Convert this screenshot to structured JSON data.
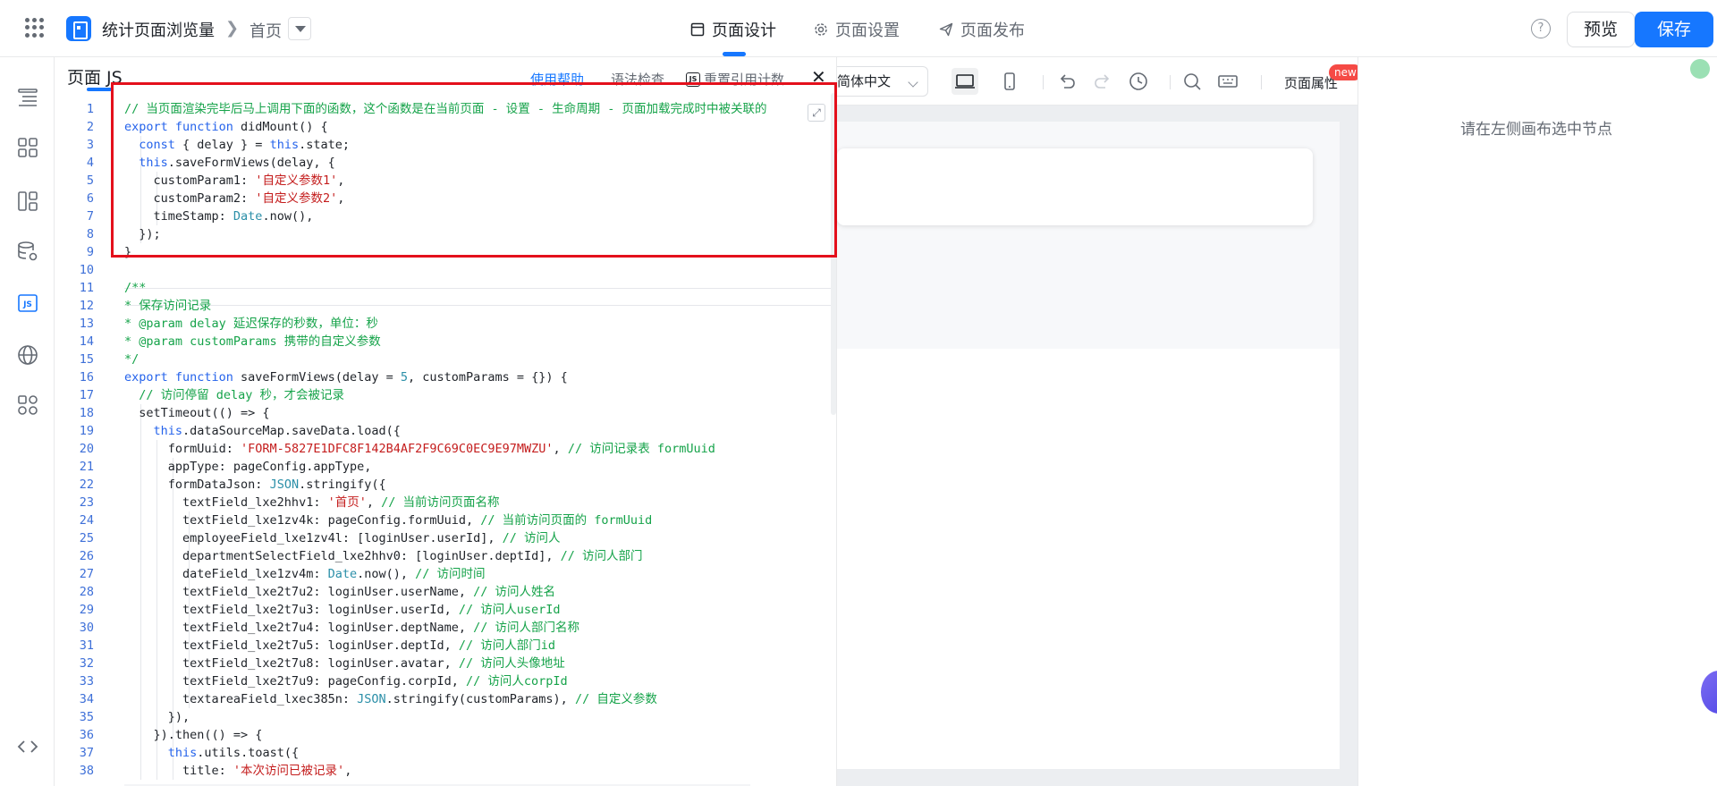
{
  "header": {
    "app_title": "统计页面浏览量",
    "breadcrumb_page": "首页",
    "tabs": [
      {
        "label": "页面设计",
        "active": true
      },
      {
        "label": "页面设置",
        "active": false
      },
      {
        "label": "页面发布",
        "active": false
      }
    ],
    "preview_label": "预览",
    "save_label": "保存",
    "help_glyph": "?"
  },
  "rail": {
    "icons": [
      "outline-icon",
      "components-icon",
      "layout-icon",
      "datasource-icon",
      "js-icon",
      "globe-icon",
      "plugins-icon",
      "code-icon"
    ],
    "js_label": "JS"
  },
  "code_panel": {
    "title": "页面 JS",
    "help_label": "使用帮助",
    "lint_label": "语法检查",
    "ref_label": "重置引用计数",
    "ref_icon_label": "JS",
    "close_glyph": "✕",
    "expand_glyph": "⤢",
    "lines": [
      [
        {
          "c": "cm",
          "t": "// 当页面渲染完毕后马上调用下面的函数，这个函数是在当前页面 - 设置 - 生命周期 - 页面加载完成时中被关联的"
        }
      ],
      [
        {
          "c": "kw",
          "t": "export function"
        },
        {
          "c": "",
          "t": " didMount() {"
        }
      ],
      [
        {
          "c": "",
          "t": "  "
        },
        {
          "c": "kw",
          "t": "const"
        },
        {
          "c": "",
          "t": " { delay } = "
        },
        {
          "c": "kw",
          "t": "this"
        },
        {
          "c": "",
          "t": ".state;"
        }
      ],
      [
        {
          "c": "",
          "t": "  "
        },
        {
          "c": "kw",
          "t": "this"
        },
        {
          "c": "",
          "t": ".saveFormViews(delay, {"
        }
      ],
      [
        {
          "c": "",
          "t": "    customParam1: "
        },
        {
          "c": "st",
          "t": "'自定义参数1'"
        },
        {
          "c": "",
          "t": ","
        }
      ],
      [
        {
          "c": "",
          "t": "    customParam2: "
        },
        {
          "c": "st",
          "t": "'自定义参数2'"
        },
        {
          "c": "",
          "t": ","
        }
      ],
      [
        {
          "c": "",
          "t": "    timeStamp: "
        },
        {
          "c": "ty",
          "t": "Date"
        },
        {
          "c": "",
          "t": ".now(),"
        }
      ],
      [
        {
          "c": "",
          "t": "  });"
        }
      ],
      [
        {
          "c": "",
          "t": "}"
        }
      ],
      [
        {
          "c": "",
          "t": ""
        }
      ],
      [
        {
          "c": "cm",
          "t": "/**"
        }
      ],
      [
        {
          "c": "cm",
          "t": "* 保存访问记录"
        }
      ],
      [
        {
          "c": "cm",
          "t": "* @param delay 延迟保存的秒数，单位：秒"
        }
      ],
      [
        {
          "c": "cm",
          "t": "* @param customParams 携带的自定义参数"
        }
      ],
      [
        {
          "c": "cm",
          "t": "*/"
        }
      ],
      [
        {
          "c": "kw",
          "t": "export function"
        },
        {
          "c": "",
          "t": " saveFormViews(delay = "
        },
        {
          "c": "ty",
          "t": "5"
        },
        {
          "c": "",
          "t": ", customParams = {}) {"
        }
      ],
      [
        {
          "c": "",
          "t": "  "
        },
        {
          "c": "cm",
          "t": "// 访问停留 delay 秒，才会被记录"
        }
      ],
      [
        {
          "c": "",
          "t": "  setTimeout(() => {"
        }
      ],
      [
        {
          "c": "",
          "t": "    "
        },
        {
          "c": "kw",
          "t": "this"
        },
        {
          "c": "",
          "t": ".dataSourceMap.saveData.load({"
        }
      ],
      [
        {
          "c": "",
          "t": "      formUuid: "
        },
        {
          "c": "st",
          "t": "'FORM-5827E1DFC8F142B4AF2F9C69C0EC9E97MWZU'"
        },
        {
          "c": "",
          "t": ", "
        },
        {
          "c": "cm",
          "t": "// 访问记录表 formUuid"
        }
      ],
      [
        {
          "c": "",
          "t": "      appType: pageConfig.appType,"
        }
      ],
      [
        {
          "c": "",
          "t": "      formDataJson: "
        },
        {
          "c": "ty",
          "t": "JSON"
        },
        {
          "c": "",
          "t": ".stringify({"
        }
      ],
      [
        {
          "c": "",
          "t": "        textField_lxe2hhv1: "
        },
        {
          "c": "st",
          "t": "'首页'"
        },
        {
          "c": "",
          "t": ", "
        },
        {
          "c": "cm",
          "t": "// 当前访问页面名称"
        }
      ],
      [
        {
          "c": "",
          "t": "        textField_lxe1zv4k: pageConfig.formUuid, "
        },
        {
          "c": "cm",
          "t": "// 当前访问页面的 formUuid"
        }
      ],
      [
        {
          "c": "",
          "t": "        employeeField_lxe1zv4l: [loginUser.userId], "
        },
        {
          "c": "cm",
          "t": "// 访问人"
        }
      ],
      [
        {
          "c": "",
          "t": "        departmentSelectField_lxe2hhv0: [loginUser.deptId], "
        },
        {
          "c": "cm",
          "t": "// 访问人部门"
        }
      ],
      [
        {
          "c": "",
          "t": "        dateField_lxe1zv4m: "
        },
        {
          "c": "ty",
          "t": "Date"
        },
        {
          "c": "",
          "t": ".now(), "
        },
        {
          "c": "cm",
          "t": "// 访问时间"
        }
      ],
      [
        {
          "c": "",
          "t": "        textField_lxe2t7u2: loginUser.userName, "
        },
        {
          "c": "cm",
          "t": "// 访问人姓名"
        }
      ],
      [
        {
          "c": "",
          "t": "        textField_lxe2t7u3: loginUser.userId, "
        },
        {
          "c": "cm",
          "t": "// 访问人userId"
        }
      ],
      [
        {
          "c": "",
          "t": "        textField_lxe2t7u4: loginUser.deptName, "
        },
        {
          "c": "cm",
          "t": "// 访问人部门名称"
        }
      ],
      [
        {
          "c": "",
          "t": "        textField_lxe2t7u5: loginUser.deptId, "
        },
        {
          "c": "cm",
          "t": "// 访问人部门id"
        }
      ],
      [
        {
          "c": "",
          "t": "        textField_lxe2t7u8: loginUser.avatar, "
        },
        {
          "c": "cm",
          "t": "// 访问人头像地址"
        }
      ],
      [
        {
          "c": "",
          "t": "        textField_lxe2t7u9: pageConfig.corpId, "
        },
        {
          "c": "cm",
          "t": "// 访问人corpId"
        }
      ],
      [
        {
          "c": "",
          "t": "        textareaField_lxec385n: "
        },
        {
          "c": "ty",
          "t": "JSON"
        },
        {
          "c": "",
          "t": ".stringify(customParams), "
        },
        {
          "c": "cm",
          "t": "// 自定义参数"
        }
      ],
      [
        {
          "c": "",
          "t": "      }),"
        }
      ],
      [
        {
          "c": "",
          "t": "    }).then(() => {"
        }
      ],
      [
        {
          "c": "",
          "t": "      "
        },
        {
          "c": "kw",
          "t": "this"
        },
        {
          "c": "",
          "t": ".utils.toast({"
        }
      ],
      [
        {
          "c": "",
          "t": "        title: "
        },
        {
          "c": "st",
          "t": "'本次访问已被记录'"
        },
        {
          "c": "",
          "t": ","
        }
      ]
    ]
  },
  "canvas": {
    "lang_label": "简体中文",
    "page_props_label": "页面属性",
    "new_badge": "new"
  },
  "right_panel": {
    "empty_hint": "请在左侧画布选中节点"
  },
  "colors": {
    "accent": "#1677ff",
    "highlight_box": "#e4101c"
  }
}
